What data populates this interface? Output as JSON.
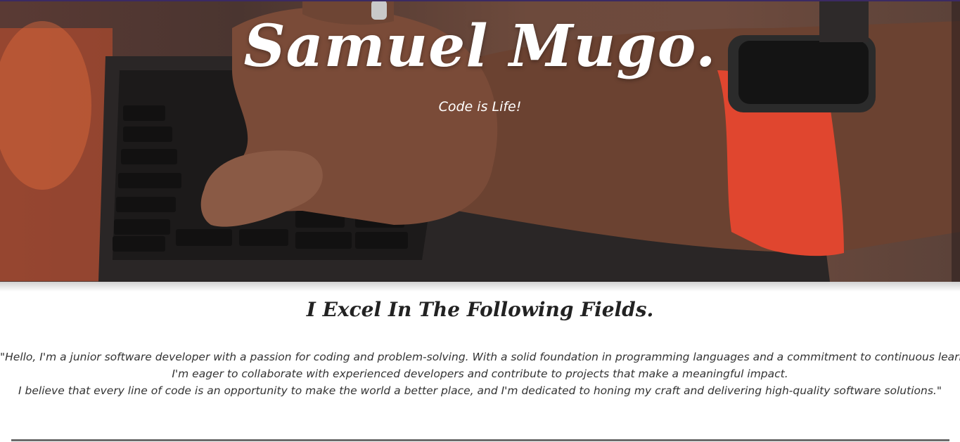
{
  "hero": {
    "title": "Samuel Mugo.",
    "subtitle": "Code is Life!",
    "background_image": "hands-typing-on-laptop-keyboard-with-orange-smartwatch"
  },
  "fields": {
    "heading": "I Excel In The Following Fields.",
    "intro_lines": [
      "\"Hello, I'm a junior software developer with a passion for coding and problem-solving. With a solid foundation in programming languages and a commitment to continuous learning,",
      "I'm eager to collaborate with experienced developers and contribute to projects that make a meaningful impact.",
      "I believe that every line of code is an opportunity to make the world a better place, and I'm dedicated to honing my craft and delivering high-quality software solutions.\""
    ]
  },
  "colors": {
    "accent_strip": "#3b2a63",
    "text_dark": "#222222",
    "watch_band": "#e0462f"
  }
}
